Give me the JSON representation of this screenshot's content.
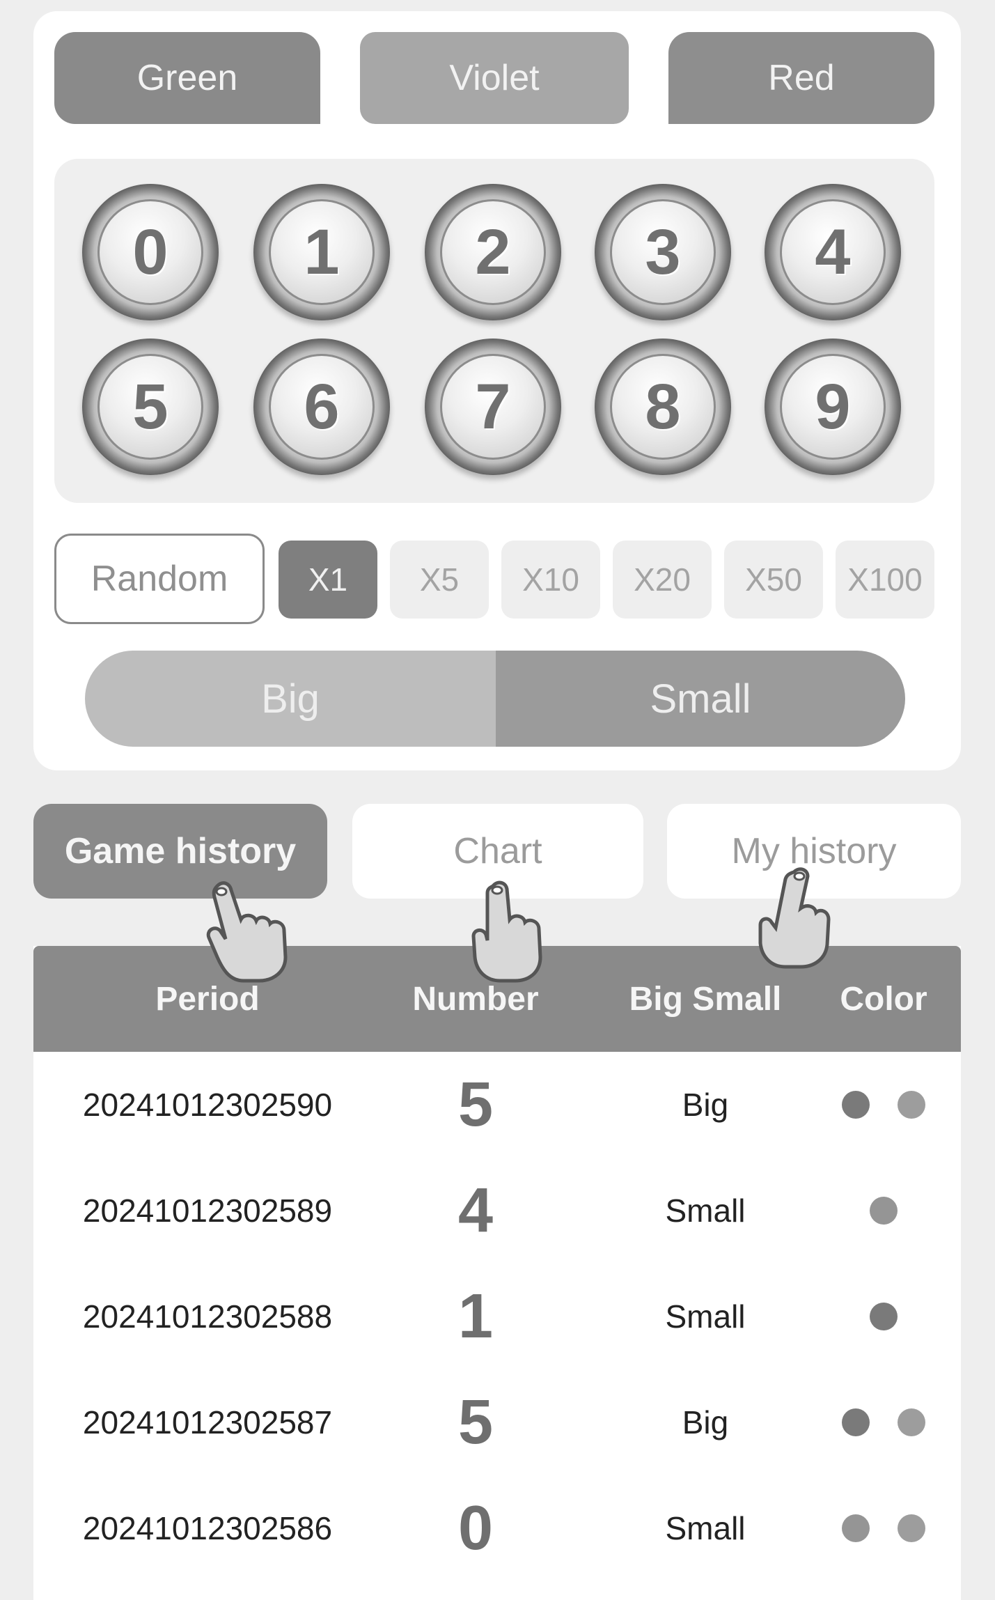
{
  "color_buttons": {
    "green": "Green",
    "violet": "Violet",
    "red": "Red"
  },
  "balls": [
    "0",
    "1",
    "2",
    "3",
    "4",
    "5",
    "6",
    "7",
    "8",
    "9"
  ],
  "multipliers": {
    "random": "Random",
    "options": [
      "X1",
      "X5",
      "X10",
      "X20",
      "X50",
      "X100"
    ],
    "selected": "X1"
  },
  "bet_size": {
    "big": "Big",
    "small": "Small"
  },
  "tabs": {
    "game_history": "Game history",
    "chart": "Chart",
    "my_history": "My history",
    "active": "Game history"
  },
  "table": {
    "headers": {
      "period": "Period",
      "number": "Number",
      "big_small": "Big Small",
      "color": "Color"
    },
    "rows": [
      {
        "period": "20241012302590",
        "number": "5",
        "big_small": "Big",
        "dots": [
          "#7a7a7a",
          "#9d9d9d"
        ]
      },
      {
        "period": "20241012302589",
        "number": "4",
        "big_small": "Small",
        "dots": [
          "#959595"
        ]
      },
      {
        "period": "20241012302588",
        "number": "1",
        "big_small": "Small",
        "dots": [
          "#7a7a7a"
        ]
      },
      {
        "period": "20241012302587",
        "number": "5",
        "big_small": "Big",
        "dots": [
          "#7a7a7a",
          "#9d9d9d"
        ]
      },
      {
        "period": "20241012302586",
        "number": "0",
        "big_small": "Small",
        "dots": [
          "#959595",
          "#9d9d9d"
        ]
      }
    ]
  }
}
